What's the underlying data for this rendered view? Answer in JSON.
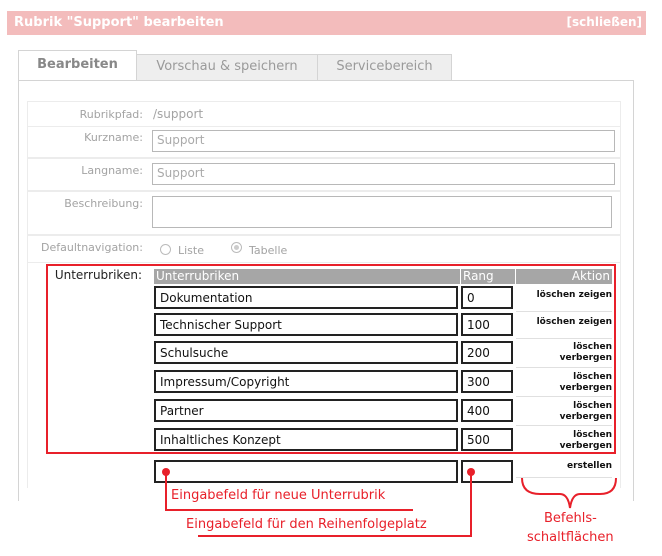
{
  "titlebar": {
    "title": "Rubrik \"Support\" bearbeiten",
    "close": "[schließen]"
  },
  "tabs": [
    "Bearbeiten",
    "Vorschau & speichern",
    "Servicebereich"
  ],
  "form": {
    "rubrikpfad": {
      "label": "Rubrikpfad:",
      "value": "/support"
    },
    "kurzname": {
      "label": "Kurzname:",
      "value": "Support"
    },
    "langname": {
      "label": "Langname:",
      "value": "Support"
    },
    "beschreibung": {
      "label": "Beschreibung:",
      "value": ""
    },
    "defaultnav": {
      "label": "Defaultnavigation:",
      "options": [
        "Liste",
        "Tabelle"
      ],
      "selected": "Tabelle"
    }
  },
  "subrubrics": {
    "label": "Unterrubriken:",
    "headers": {
      "name": "Unterrubriken",
      "rank": "Rang",
      "action": "Aktion"
    },
    "rows": [
      {
        "name": "Dokumentation",
        "rank": "0",
        "action1": "löschen",
        "action2": "zeigen"
      },
      {
        "name": "Technischer Support",
        "rank": "100",
        "action1": "löschen",
        "action2": "zeigen"
      },
      {
        "name": "Schulsuche",
        "rank": "200",
        "action1": "löschen",
        "action2": "verbergen"
      },
      {
        "name": "Impressum/Copyright",
        "rank": "300",
        "action1": "löschen",
        "action2": "verbergen"
      },
      {
        "name": "Partner",
        "rank": "400",
        "action1": "löschen",
        "action2": "verbergen"
      },
      {
        "name": "Inhaltliches Konzept",
        "rank": "500",
        "action1": "löschen",
        "action2": "verbergen"
      }
    ],
    "new_row": {
      "name": "",
      "rank": "",
      "action": "erstellen"
    }
  },
  "annotations": {
    "new_input": "Eingabefeld für neue Unterrubrik",
    "rank_input": "Eingabefeld für den Reihenfolgeplatz",
    "buttons_line1": "Befehls-",
    "buttons_line2": "schaltflächen"
  },
  "colors": {
    "annotation": "#e8202a",
    "titlebar": "#f3bcbc",
    "table_header": "#a6a6a6"
  }
}
